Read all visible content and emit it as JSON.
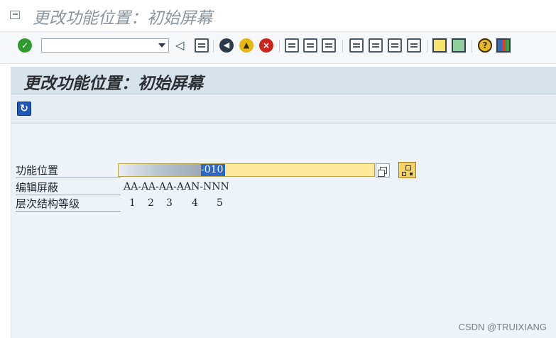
{
  "window": {
    "title": "更改功能位置：初始屏幕"
  },
  "toolbar": {
    "command_field": "",
    "icons": [
      "ok-icon",
      "back-arrow-icon",
      "save-icon",
      "back-icon",
      "exit-icon",
      "cancel-icon",
      "print-icon",
      "find-icon",
      "find-next-icon",
      "first-page-icon",
      "prev-page-icon",
      "next-page-icon",
      "last-page-icon",
      "new-session-icon",
      "shortcut-icon",
      "help-icon",
      "customize-layout-icon"
    ]
  },
  "screen": {
    "title": "更改功能位置：初始屏幕",
    "fields": [
      {
        "label": "功能位置",
        "value_selected": "-010"
      },
      {
        "label": "编辑屏蔽",
        "value": "AA-AA-AA-AAN-NNN"
      },
      {
        "label": "层次结构等级",
        "values": [
          "1",
          "2",
          "3",
          "4",
          "5"
        ]
      }
    ]
  },
  "watermark": "CSDN @TRUIXIANG",
  "colors": {
    "accent": "#2d68c4",
    "input_bg": "#fde99a",
    "panel_bg": "#eef3f7",
    "header_bg": "#d8e2ea"
  }
}
